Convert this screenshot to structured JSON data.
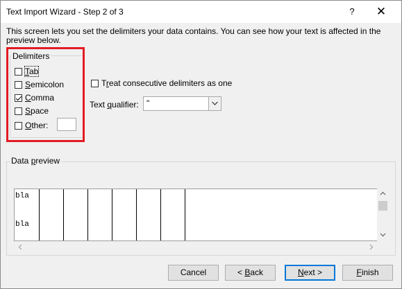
{
  "window": {
    "title": "Text Import Wizard - Step 2 of 3",
    "help_glyph": "?",
    "close_glyph": "✕"
  },
  "description": "This screen lets you set the delimiters your data contains.  You can see how your text is affected in the preview below.",
  "delimiters": {
    "group_label": "Delimiters",
    "items": [
      {
        "key": "tab",
        "pre": "",
        "mnemonic": "T",
        "post": "ab",
        "checked": false
      },
      {
        "key": "semicolon",
        "pre": "",
        "mnemonic": "S",
        "post": "emicolon",
        "checked": false
      },
      {
        "key": "comma",
        "pre": "",
        "mnemonic": "C",
        "post": "omma",
        "checked": true
      },
      {
        "key": "space",
        "pre": "",
        "mnemonic": "S",
        "post": "pace",
        "checked": false
      },
      {
        "key": "other",
        "pre": "",
        "mnemonic": "O",
        "post": "ther:",
        "checked": false
      }
    ],
    "other_value": ""
  },
  "consecutive": {
    "pre": "T",
    "mnemonic": "r",
    "post": "eat consecutive delimiters as one",
    "checked": false
  },
  "qualifier": {
    "pre": "Text ",
    "mnemonic": "q",
    "post": "ualifier:",
    "value": "\""
  },
  "preview": {
    "label_pre": "Data ",
    "label_mnemonic": "p",
    "label_post": "review",
    "rows": [
      "bla",
      "bla"
    ]
  },
  "buttons": {
    "cancel": {
      "pre": "",
      "mnemonic": "",
      "post": "Cancel"
    },
    "back": {
      "pre": "< ",
      "mnemonic": "B",
      "post": "ack"
    },
    "next": {
      "pre": "",
      "mnemonic": "N",
      "post": "ext >"
    },
    "finish": {
      "pre": "",
      "mnemonic": "F",
      "post": "inish"
    }
  },
  "accent_color": "#e21b23"
}
